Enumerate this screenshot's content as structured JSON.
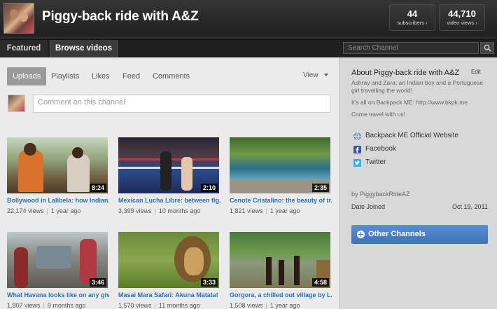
{
  "header": {
    "channel_title": "Piggy-back ride with A&Z",
    "subscribers_count": "44",
    "subscribers_label": "subscribers ›",
    "views_count": "44,710",
    "views_label": "video views ›"
  },
  "tabs": [
    {
      "label": "Featured"
    },
    {
      "label": "Browse videos"
    }
  ],
  "search": {
    "placeholder": "Search Channel"
  },
  "subtabs": [
    {
      "label": "Uploads",
      "active": true
    },
    {
      "label": "Playlists"
    },
    {
      "label": "Likes"
    },
    {
      "label": "Feed"
    },
    {
      "label": "Comments"
    }
  ],
  "view_select": {
    "label": "View"
  },
  "comment": {
    "placeholder": "Comment on this channel"
  },
  "videos": [
    {
      "title": "Bollywood in Lalibela: how Indian...",
      "duration": "8:24",
      "views": "22,174 views",
      "age": "1 year ago"
    },
    {
      "title": "Mexican Lucha Libre: between fig...",
      "duration": "2:10",
      "views": "3,399 views",
      "age": "10 months ago"
    },
    {
      "title": "Cenote Cristalino: the beauty of tr...",
      "duration": "2:35",
      "views": "1,821 views",
      "age": "1 year ago"
    },
    {
      "title": "What Havana looks like on any giv...",
      "duration": "3:46",
      "views": "1,807 views",
      "age": "9 months ago"
    },
    {
      "title": "Masai Mara Safari: Akuna Matata!",
      "duration": "3:33",
      "views": "1,570 views",
      "age": "11 months ago"
    },
    {
      "title": "Gorgora, a chilled out village by L...",
      "duration": "4:58",
      "views": "1,508 views",
      "age": "1 year ago"
    }
  ],
  "sidebar": {
    "about_title": "About Piggy-back ride with A&Z",
    "edit_label": "Edit",
    "about_line1": "Ashray and Zara: an Indian boy and a Portuguese girl travelling the world!",
    "about_line2": "It's all on Backpack ME: http://www.bkpk.me",
    "about_line3": "Come travel with us!",
    "links": [
      {
        "label": "Backpack ME Official Website",
        "icon": "globe-icon"
      },
      {
        "label": "Facebook",
        "icon": "facebook-icon"
      },
      {
        "label": "Twitter",
        "icon": "twitter-icon"
      }
    ],
    "by": "by PiggybackRideAZ",
    "date_joined_label": "Date Joined",
    "date_joined_value": "Oct 19, 2011",
    "other_channels": "Other Channels"
  },
  "colors": {
    "link_blue": "#2a6fb8",
    "button_blue": "#4a80c4"
  }
}
